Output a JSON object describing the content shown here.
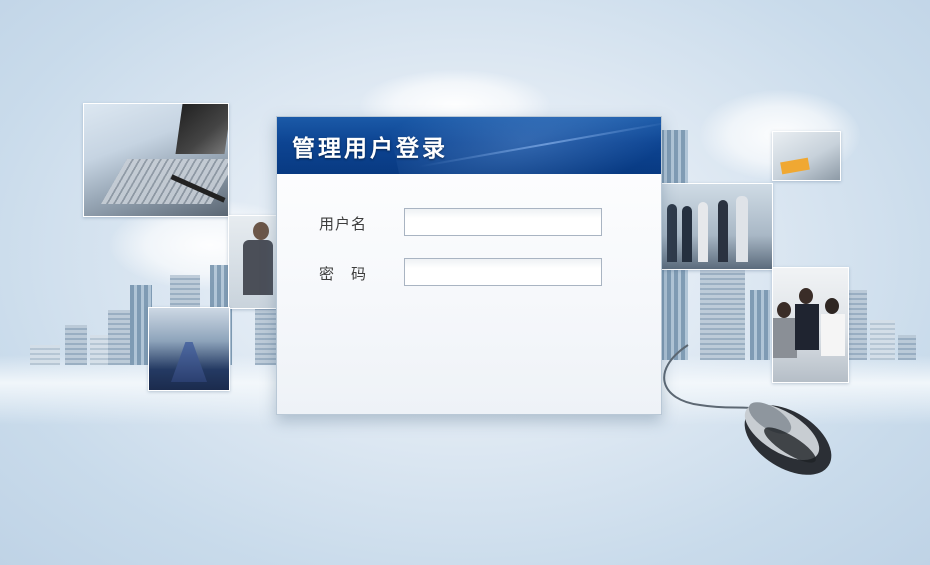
{
  "login": {
    "title": "管理用户登录",
    "username_label": "用户名",
    "password_label": "密　码",
    "username_value": "",
    "password_value": ""
  },
  "theme": {
    "header_color": "#0d4492",
    "background": "#c9dbeb"
  },
  "decor": {
    "photos": [
      "laptop-photo",
      "businessman-photo",
      "meeting-room-photo",
      "team-photo",
      "office-desk-photo",
      "office-workers-photo"
    ],
    "icons": [
      "computer-mouse-icon"
    ]
  }
}
